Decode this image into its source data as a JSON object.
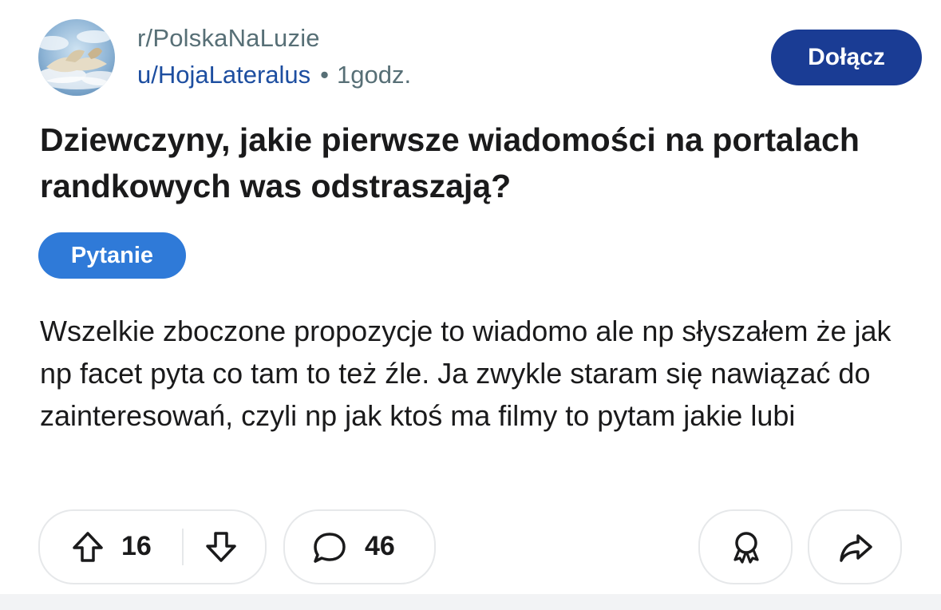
{
  "post": {
    "subreddit": "r/PolskaNaLuzie",
    "author": "u/HojaLateralus",
    "separator": "•",
    "time": "1godz.",
    "join_label": "Dołącz",
    "title": "Dziewczyny, jakie pierwsze wiadomości na portalach randkowych was odstraszają?",
    "flair": "Pytanie",
    "body": "Wszelkie zboczone propozycje to wiadomo ale np słyszałem że jak np facet pyta co tam to też źle. Ja zwykle staram się nawiązać do zainteresowań, czyli np jak ktoś ma filmy to pytam jakie lubi"
  },
  "actions": {
    "upvote_count": "16",
    "comment_count": "46"
  },
  "icons": {
    "upvote": "upvote-arrow-icon",
    "downvote": "downvote-arrow-icon",
    "comment": "comment-bubble-icon",
    "award": "award-ribbon-icon",
    "share": "share-arrow-icon"
  },
  "colors": {
    "join_button": "#1a3c94",
    "flair": "#2f7ad8",
    "username": "#1d4ea0",
    "muted_text": "#576f76"
  }
}
